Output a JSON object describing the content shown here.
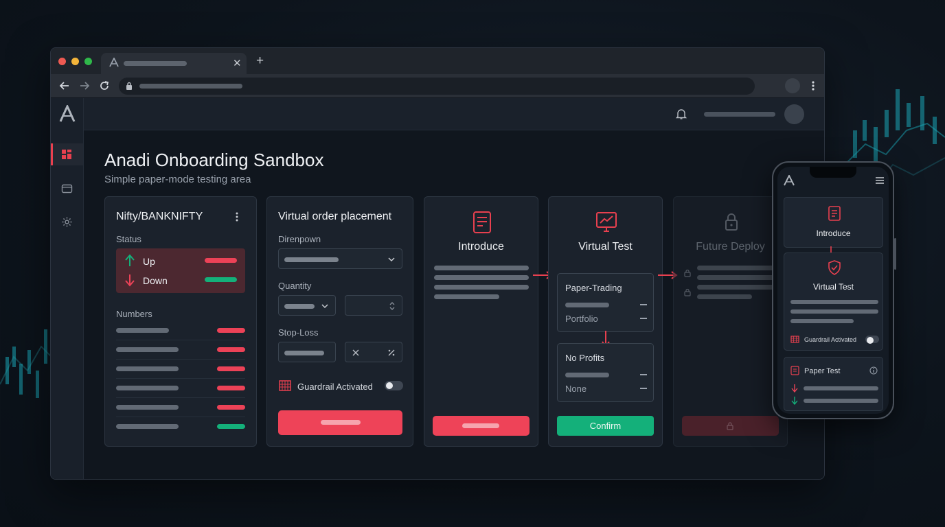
{
  "app": {
    "title": "Anadi Onboarding Sandbox",
    "subtitle": "Simple paper-mode testing area"
  },
  "sidebar": {
    "items": [
      {
        "name": "dashboard",
        "active": true
      },
      {
        "name": "wallet",
        "active": false
      },
      {
        "name": "settings",
        "active": false
      }
    ]
  },
  "market_card": {
    "title": "Nifty/BANKNIFTY",
    "status_label": "Status",
    "up_label": "Up",
    "down_label": "Down",
    "numbers_label": "Numbers",
    "number_rows": [
      "red",
      "red",
      "red",
      "red",
      "red",
      "green"
    ]
  },
  "order_card": {
    "title": "Virtual order placement",
    "dropdown_label": "Direnpown",
    "quantity_label": "Quantity",
    "stoploss_label": "Stop-Loss",
    "guardrail_label": "Guardrail Activated",
    "guardrail_on": false
  },
  "flow": {
    "introduce": {
      "title": "Introduce"
    },
    "virtual_test": {
      "title": "Virtual Test",
      "box1_title": "Paper-Trading",
      "box1_sub": "Portfolio",
      "box2_title": "No Profits",
      "box2_sub": "None",
      "confirm_label": "Confirm"
    },
    "future_deploy": {
      "title": "Future Deploy",
      "locked": true
    }
  },
  "mobile": {
    "introduce_title": "Introduce",
    "virtual_test_title": "Virtual Test",
    "guardrail_label": "Guardrail Activated",
    "paper_test_title": "Paper Test"
  },
  "colors": {
    "accent_red": "#ee4358",
    "accent_green": "#14b07a",
    "background": "#10161e",
    "card": "#1b222c"
  }
}
